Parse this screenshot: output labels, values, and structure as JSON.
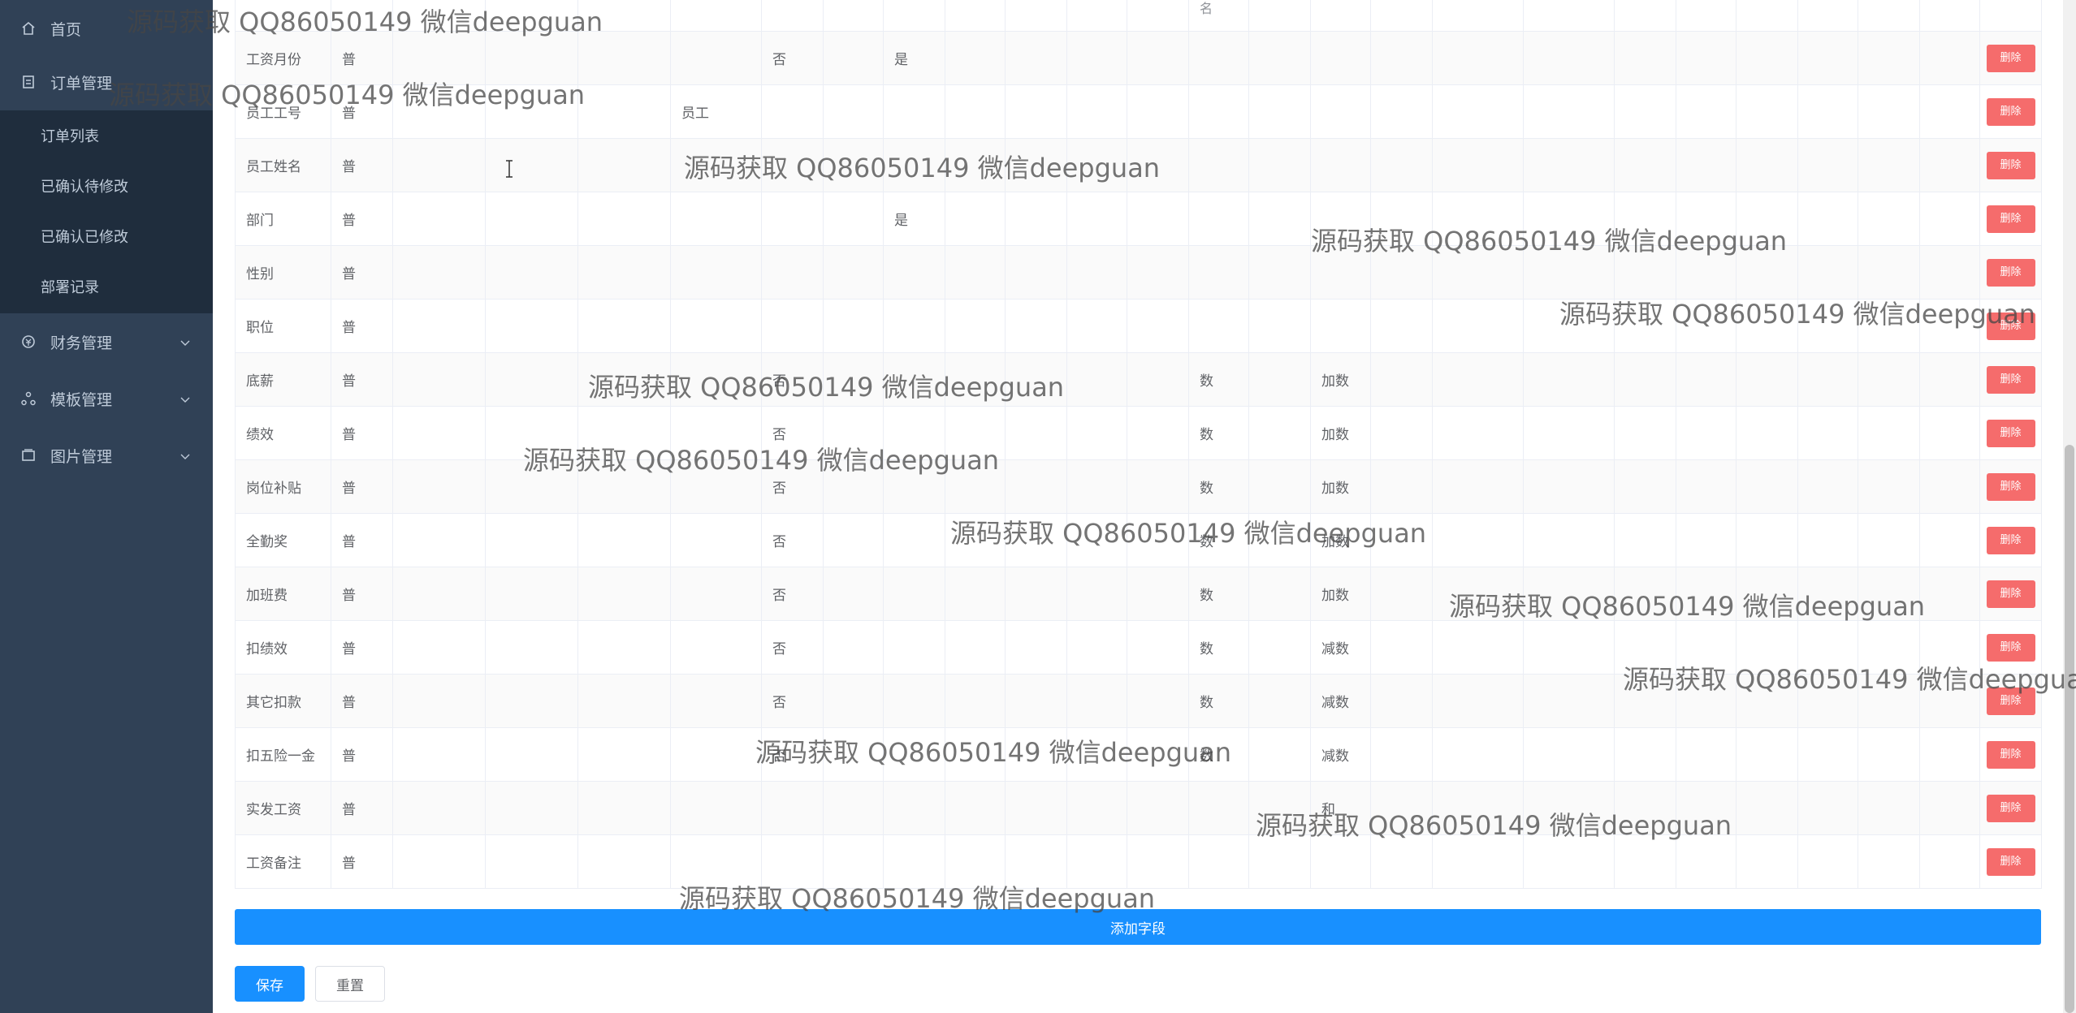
{
  "sidebar": {
    "home": {
      "label": "首页",
      "icon": "home-icon"
    },
    "order_mgmt": {
      "label": "订单管理",
      "icon": "document-icon"
    },
    "order_sub": [
      "订单列表",
      "已确认待修改",
      "已确认已修改",
      "部署记录"
    ],
    "finance": {
      "label": "财务管理",
      "icon": "finance-icon"
    },
    "template": {
      "label": "模板管理",
      "icon": "template-icon"
    },
    "images": {
      "label": "图片管理",
      "icon": "image-icon"
    }
  },
  "table": {
    "stub_cells": [
      "",
      "",
      "",
      "",
      "",
      "",
      "",
      "",
      "",
      "",
      "",
      "",
      "",
      "",
      "",
      "",
      "",
      "",
      "",
      "",
      "",
      "",
      "",
      "",
      "",
      "",
      "",
      "",
      ""
    ],
    "stub_text": {
      "c12": "名"
    },
    "rows": [
      {
        "name": "工资月份",
        "type": "普",
        "c6": "否",
        "c8": "是",
        "c12": "",
        "c14": ""
      },
      {
        "name": "员工工号",
        "type": "普",
        "c5": "员工",
        "c6": "",
        "c8": "",
        "c12": "",
        "c14": ""
      },
      {
        "name": "员工姓名",
        "type": "普",
        "c6": "",
        "c8": "",
        "c12": "",
        "c14": ""
      },
      {
        "name": "部门",
        "type": "普",
        "c6": "",
        "c8": "是",
        "c12": "",
        "c14": ""
      },
      {
        "name": "性别",
        "type": "普",
        "c6": "",
        "c8": "",
        "c12": "",
        "c14": ""
      },
      {
        "name": "职位",
        "type": "普",
        "c6": "",
        "c8": "",
        "c12": "",
        "c14": ""
      },
      {
        "name": "底薪",
        "type": "普",
        "c6": "否",
        "c8": "",
        "c12": "数",
        "c14": "加数"
      },
      {
        "name": "绩效",
        "type": "普",
        "c6": "否",
        "c8": "",
        "c12": "数",
        "c14": "加数"
      },
      {
        "name": "岗位补贴",
        "type": "普",
        "c6": "否",
        "c8": "",
        "c12": "数",
        "c14": "加数"
      },
      {
        "name": "全勤奖",
        "type": "普",
        "c6": "否",
        "c8": "",
        "c12": "数",
        "c14": "加数"
      },
      {
        "name": "加班费",
        "type": "普",
        "c6": "否",
        "c8": "",
        "c12": "数",
        "c14": "加数"
      },
      {
        "name": "扣绩效",
        "type": "普",
        "c6": "否",
        "c8": "",
        "c12": "数",
        "c14": "减数"
      },
      {
        "name": "其它扣款",
        "type": "普",
        "c6": "否",
        "c8": "",
        "c12": "数",
        "c14": "减数"
      },
      {
        "name": "扣五险一金",
        "type": "普",
        "c6": "否",
        "c8": "",
        "c12": "数",
        "c14": "减数"
      },
      {
        "name": "实发工资",
        "type": "普",
        "c6": "",
        "c8": "",
        "c12": "",
        "c14": "和"
      },
      {
        "name": "工资备注",
        "type": "普",
        "c6": "",
        "c8": "",
        "c12": "",
        "c14": ""
      }
    ],
    "delete_label": "删除"
  },
  "add_field_label": "添加字段",
  "save_label": "保存",
  "reset_label": "重置",
  "watermark": "源码获取 QQ86050149 微信deepguan",
  "colors": {
    "sidebar_bg": "#304156",
    "submenu_bg": "#1f2d3d",
    "primary": "#1890ff",
    "danger": "#f56c6c"
  }
}
